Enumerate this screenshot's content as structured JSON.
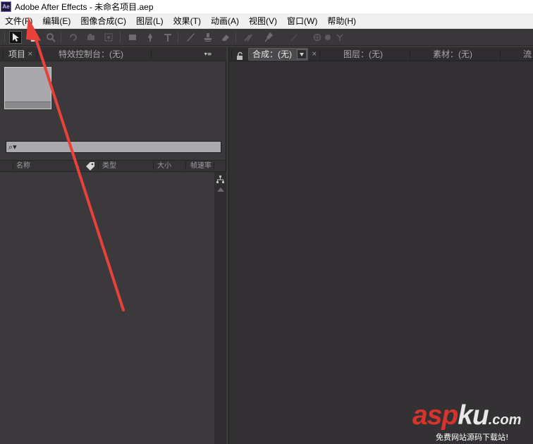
{
  "window": {
    "app_icon_label": "Ae",
    "title": "Adobe After Effects - 未命名项目.aep"
  },
  "menu": [
    "文件(F)",
    "编辑(E)",
    "图像合成(C)",
    "图层(L)",
    "效果(T)",
    "动画(A)",
    "视图(V)",
    "窗口(W)",
    "帮助(H)"
  ],
  "toolbar": {
    "tools": [
      "selection-tool",
      "hand-tool",
      "zoom-tool",
      "rotation-tool",
      "camera-tool",
      "pan-behind-tool",
      "rectangle-mask-tool",
      "pen-tool",
      "type-tool",
      "brush-tool",
      "clone-stamp-tool",
      "eraser-tool",
      "roto-brush-tool",
      "puppet-tool"
    ],
    "active_tool": "selection-tool"
  },
  "project_panel": {
    "tab_project": "项目",
    "tab_effects": "特效控制台：(无)",
    "search_placeholder": "",
    "columns": [
      "名称",
      "类型",
      "大小",
      "帧速率"
    ]
  },
  "composition_panel": {
    "tab_comp": "合成：(无)",
    "tab_layer": "图层：(无)",
    "tab_footage": "素材：(无)",
    "tab_flow": "流"
  },
  "watermark": {
    "brand_red": "asp",
    "brand_white": "ku",
    "brand_tld": ".com",
    "sub": "免费网站源码下载站!"
  },
  "colors": {
    "panel_bg": "#3b393c",
    "comp_bg": "#333134",
    "annotation_arrow": "#e8413a"
  }
}
